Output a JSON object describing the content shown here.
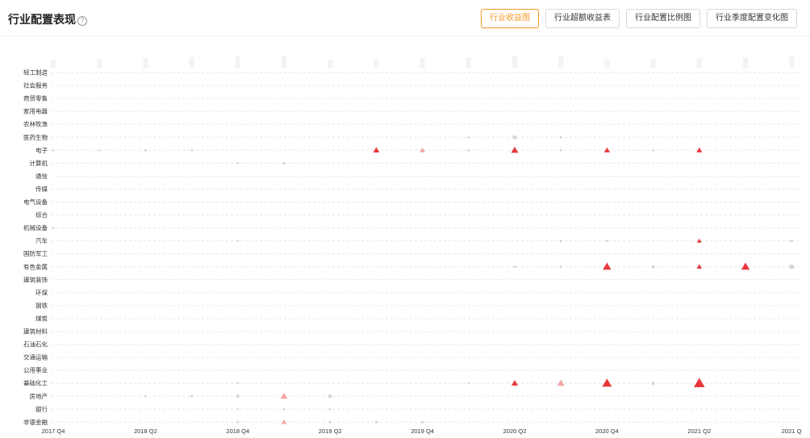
{
  "header": {
    "title": "行业配置表现",
    "help_icon": "question-circle-icon",
    "tabs": [
      {
        "label": "行业收益图",
        "active": true
      },
      {
        "label": "行业超额收益表",
        "active": false
      },
      {
        "label": "行业配置比例图",
        "active": false
      },
      {
        "label": "行业季度配置变化图",
        "active": false
      }
    ]
  },
  "chart_data": {
    "type": "scatter",
    "x_ticks": [
      "2017 Q4",
      "2018 Q2",
      "2018 Q4",
      "2019 Q2",
      "2019 Q4",
      "2020 Q2",
      "2020 Q4",
      "2021 Q2",
      "2021 Q"
    ],
    "quarters": [
      "2017 Q4",
      "2018 Q1",
      "2018 Q2",
      "2018 Q3",
      "2018 Q4",
      "2019 Q1",
      "2019 Q2",
      "2019 Q3",
      "2019 Q4",
      "2020 Q1",
      "2020 Q2",
      "2020 Q3",
      "2020 Q4",
      "2021 Q1",
      "2021 Q2",
      "2021 Q3",
      "2021 Q4"
    ],
    "categories": [
      "轻工制造",
      "社会服务",
      "商贸零售",
      "家用电器",
      "农林牧渔",
      "医药生物",
      "电子",
      "计算机",
      "通信",
      "传媒",
      "电气设备",
      "综合",
      "机械设备",
      "汽车",
      "国防军工",
      "有色金属",
      "建筑装饰",
      "环保",
      "钢铁",
      "煤炭",
      "建筑材料",
      "石油石化",
      "交通运输",
      "公用事业",
      "基础化工",
      "房地产",
      "银行",
      "非银金融"
    ],
    "colors": {
      "gain": "#e8383d",
      "gain_light": "#f4a5a7",
      "neutral": "#cccccc",
      "grid": "#e6e6e6"
    },
    "points": [
      {
        "category": "医药生物",
        "quarter": "2020 Q1",
        "value": 0.2,
        "shape": "circle"
      },
      {
        "category": "医药生物",
        "quarter": "2020 Q2",
        "value": 1.0,
        "shape": "circle"
      },
      {
        "category": "医药生物",
        "quarter": "2020 Q3",
        "value": 0.4,
        "shape": "circle"
      },
      {
        "category": "电子",
        "quarter": "2017 Q4",
        "value": 0.3,
        "shape": "circle"
      },
      {
        "category": "电子",
        "quarter": "2018 Q1",
        "value": 0.2,
        "shape": "circle"
      },
      {
        "category": "电子",
        "quarter": "2018 Q2",
        "value": 0.3,
        "shape": "circle"
      },
      {
        "category": "电子",
        "quarter": "2018 Q3",
        "value": 0.2,
        "shape": "circle"
      },
      {
        "category": "电子",
        "quarter": "2019 Q3",
        "value": 1.2,
        "shape": "triangle"
      },
      {
        "category": "电子",
        "quarter": "2019 Q4",
        "value": 0.9,
        "shape": "triangle_light"
      },
      {
        "category": "电子",
        "quarter": "2020 Q1",
        "value": 0.3,
        "shape": "circle"
      },
      {
        "category": "电子",
        "quarter": "2020 Q2",
        "value": 1.5,
        "shape": "triangle"
      },
      {
        "category": "电子",
        "quarter": "2020 Q3",
        "value": 0.2,
        "shape": "circle"
      },
      {
        "category": "电子",
        "quarter": "2020 Q4",
        "value": 1.0,
        "shape": "triangle"
      },
      {
        "category": "电子",
        "quarter": "2021 Q1",
        "value": 0.3,
        "shape": "circle"
      },
      {
        "category": "电子",
        "quarter": "2021 Q2",
        "value": 1.0,
        "shape": "triangle"
      },
      {
        "category": "计算机",
        "quarter": "2018 Q4",
        "value": 0.2,
        "shape": "circle"
      },
      {
        "category": "计算机",
        "quarter": "2019 Q1",
        "value": 0.4,
        "shape": "circle"
      },
      {
        "category": "机械设备",
        "quarter": "2017 Q4",
        "value": 0.3,
        "shape": "circle"
      },
      {
        "category": "汽车",
        "quarter": "2018 Q4",
        "value": 0.2,
        "shape": "circle"
      },
      {
        "category": "汽车",
        "quarter": "2020 Q3",
        "value": 0.4,
        "shape": "circle"
      },
      {
        "category": "汽车",
        "quarter": "2020 Q4",
        "value": 0.3,
        "shape": "circle"
      },
      {
        "category": "汽车",
        "quarter": "2021 Q2",
        "value": 0.6,
        "shape": "triangle"
      },
      {
        "category": "汽车",
        "quarter": "2021 Q4",
        "value": 0.4,
        "shape": "circle"
      },
      {
        "category": "有色金属",
        "quarter": "2020 Q2",
        "value": 0.3,
        "shape": "circle"
      },
      {
        "category": "有色金属",
        "quarter": "2020 Q3",
        "value": 0.3,
        "shape": "circle"
      },
      {
        "category": "有色金属",
        "quarter": "2020 Q4",
        "value": 2.0,
        "shape": "triangle"
      },
      {
        "category": "有色金属",
        "quarter": "2021 Q1",
        "value": 0.6,
        "shape": "circle"
      },
      {
        "category": "有色金属",
        "quarter": "2021 Q2",
        "value": 0.8,
        "shape": "triangle"
      },
      {
        "category": "有色金属",
        "quarter": "2021 Q3",
        "value": 2.0,
        "shape": "triangle"
      },
      {
        "category": "有色金属",
        "quarter": "2021 Q4",
        "value": 1.2,
        "shape": "circle"
      },
      {
        "category": "基础化工",
        "quarter": "2018 Q4",
        "value": 0.3,
        "shape": "circle"
      },
      {
        "category": "基础化工",
        "quarter": "2020 Q1",
        "value": 0.2,
        "shape": "circle"
      },
      {
        "category": "基础化工",
        "quarter": "2020 Q2",
        "value": 1.3,
        "shape": "triangle"
      },
      {
        "category": "基础化工",
        "quarter": "2020 Q3",
        "value": 1.6,
        "shape": "triangle_light"
      },
      {
        "category": "基础化工",
        "quarter": "2020 Q4",
        "value": 2.5,
        "shape": "triangle"
      },
      {
        "category": "基础化工",
        "quarter": "2021 Q1",
        "value": 0.6,
        "shape": "circle"
      },
      {
        "category": "基础化工",
        "quarter": "2021 Q2",
        "value": 3.0,
        "shape": "triangle"
      },
      {
        "category": "房地产",
        "quarter": "2018 Q2",
        "value": 0.2,
        "shape": "circle"
      },
      {
        "category": "房地产",
        "quarter": "2018 Q3",
        "value": 0.3,
        "shape": "circle"
      },
      {
        "category": "房地产",
        "quarter": "2018 Q4",
        "value": 0.6,
        "shape": "circle"
      },
      {
        "category": "房地产",
        "quarter": "2019 Q1",
        "value": 1.5,
        "shape": "triangle_light"
      },
      {
        "category": "房地产",
        "quarter": "2019 Q2",
        "value": 0.8,
        "shape": "circle"
      },
      {
        "category": "银行",
        "quarter": "2018 Q4",
        "value": 0.2,
        "shape": "circle"
      },
      {
        "category": "银行",
        "quarter": "2019 Q1",
        "value": 0.2,
        "shape": "circle"
      },
      {
        "category": "银行",
        "quarter": "2019 Q2",
        "value": 0.2,
        "shape": "circle"
      },
      {
        "category": "非银金融",
        "quarter": "2018 Q4",
        "value": 0.3,
        "shape": "circle"
      },
      {
        "category": "非银金融",
        "quarter": "2019 Q1",
        "value": 0.8,
        "shape": "triangle_light"
      },
      {
        "category": "非银金融",
        "quarter": "2019 Q2",
        "value": 0.3,
        "shape": "circle"
      },
      {
        "category": "非银金融",
        "quarter": "2019 Q3",
        "value": 0.4,
        "shape": "circle"
      },
      {
        "category": "非银金融",
        "quarter": "2019 Q4",
        "value": 0.4,
        "shape": "circle"
      }
    ],
    "grid": true,
    "legend": "none"
  }
}
